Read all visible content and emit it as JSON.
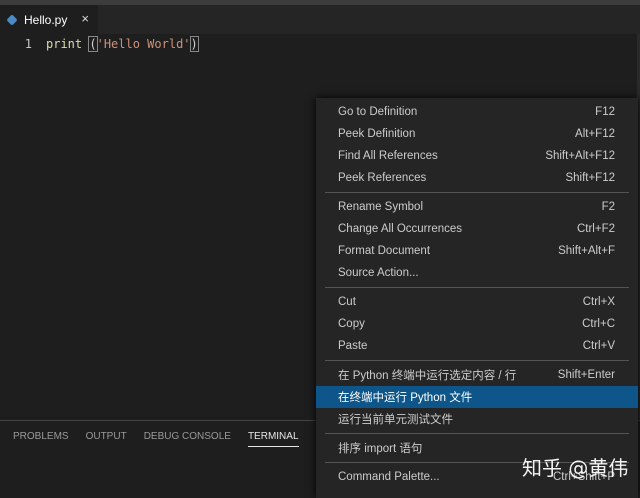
{
  "tab": {
    "file": "Hello.py",
    "close": "×"
  },
  "editor": {
    "line_number": "1",
    "keyword": "print",
    "open": "(",
    "string": "'Hello World'",
    "close": ")"
  },
  "panel": {
    "tabs": [
      "PROBLEMS",
      "OUTPUT",
      "DEBUG CONSOLE",
      "TERMINAL"
    ],
    "active": "TERMINAL"
  },
  "menu": {
    "groups": [
      [
        {
          "label": "Go to Definition",
          "key": "F12"
        },
        {
          "label": "Peek Definition",
          "key": "Alt+F12"
        },
        {
          "label": "Find All References",
          "key": "Shift+Alt+F12"
        },
        {
          "label": "Peek References",
          "key": "Shift+F12"
        }
      ],
      [
        {
          "label": "Rename Symbol",
          "key": "F2"
        },
        {
          "label": "Change All Occurrences",
          "key": "Ctrl+F2"
        },
        {
          "label": "Format Document",
          "key": "Shift+Alt+F"
        },
        {
          "label": "Source Action...",
          "key": ""
        }
      ],
      [
        {
          "label": "Cut",
          "key": "Ctrl+X"
        },
        {
          "label": "Copy",
          "key": "Ctrl+C"
        },
        {
          "label": "Paste",
          "key": "Ctrl+V"
        }
      ],
      [
        {
          "label": "在 Python 终端中运行选定内容 / 行",
          "key": "Shift+Enter"
        },
        {
          "label": "在终端中运行 Python 文件",
          "key": "",
          "highlighted": true
        },
        {
          "label": "运行当前单元测试文件",
          "key": ""
        }
      ],
      [
        {
          "label": "排序 import 语句",
          "key": ""
        }
      ],
      [
        {
          "label": "Command Palette...",
          "key": "Ctrl+Shift+P"
        }
      ]
    ]
  },
  "watermark": "知乎 @黄伟",
  "colors": {
    "highlight": "#0e5689",
    "string": "#ce9178",
    "function": "#dcdcaa"
  }
}
